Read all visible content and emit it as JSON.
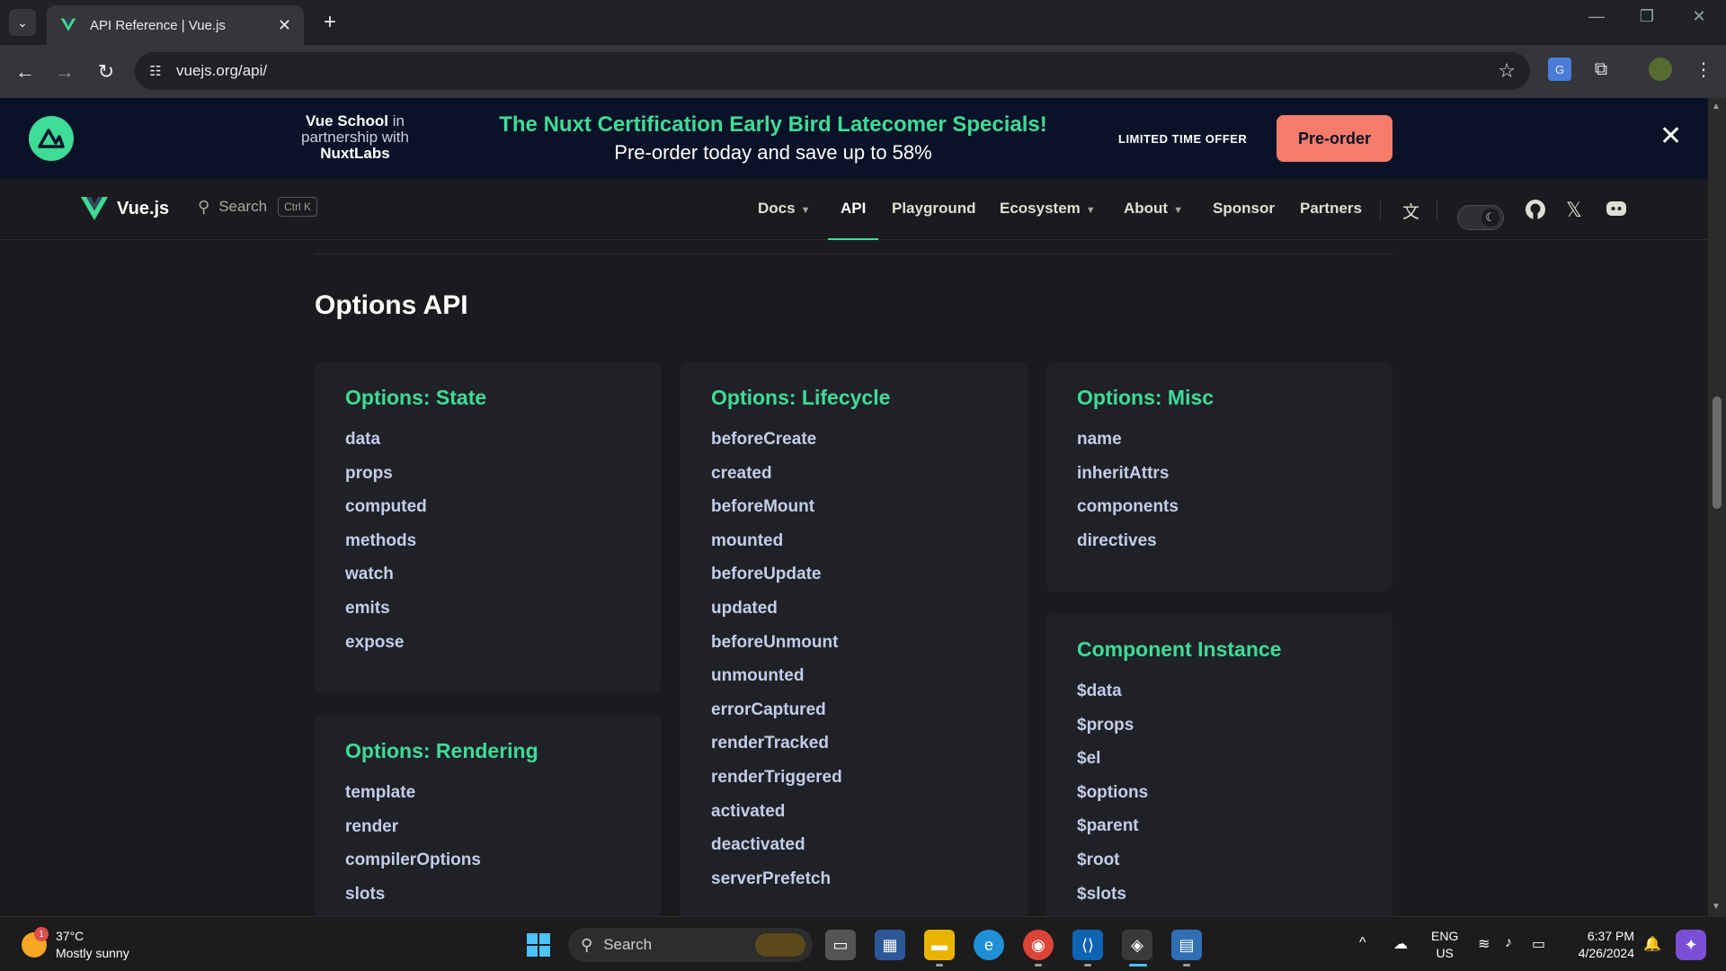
{
  "browser": {
    "tab_title": "API Reference | Vue.js",
    "url": "vuejs.org/api/"
  },
  "banner": {
    "brand_line1": "Vue School",
    "brand_line1_suffix": " in",
    "brand_line2": "partnership with",
    "brand_line3": "NuxtLabs",
    "headline": "The Nuxt Certification Early Bird Latecomer Specials!",
    "subline": "Pre-order today and save up to 58%",
    "limited": "LIMITED TIME OFFER",
    "cta": "Pre-order"
  },
  "nav": {
    "brand": "Vue.js",
    "search_label": "Search",
    "search_shortcut": "Ctrl K",
    "items": [
      {
        "label": "Docs"
      },
      {
        "label": "API"
      },
      {
        "label": "Playground"
      },
      {
        "label": "Ecosystem"
      },
      {
        "label": "About"
      },
      {
        "label": "Sponsor"
      },
      {
        "label": "Partners"
      }
    ]
  },
  "content": {
    "section_title": "Options API",
    "cards": {
      "state": {
        "title": "Options: State",
        "items": [
          "data",
          "props",
          "computed",
          "methods",
          "watch",
          "emits",
          "expose"
        ]
      },
      "rendering": {
        "title": "Options: Rendering",
        "items": [
          "template",
          "render",
          "compilerOptions",
          "slots"
        ]
      },
      "lifecycle": {
        "title": "Options: Lifecycle",
        "items": [
          "beforeCreate",
          "created",
          "beforeMount",
          "mounted",
          "beforeUpdate",
          "updated",
          "beforeUnmount",
          "unmounted",
          "errorCaptured",
          "renderTracked",
          "renderTriggered",
          "activated",
          "deactivated",
          "serverPrefetch"
        ]
      },
      "misc": {
        "title": "Options: Misc",
        "items": [
          "name",
          "inheritAttrs",
          "components",
          "directives"
        ]
      },
      "instance": {
        "title": "Component Instance",
        "items": [
          "$data",
          "$props",
          "$el",
          "$options",
          "$parent",
          "$root",
          "$slots"
        ]
      }
    }
  },
  "taskbar": {
    "temp": "37°C",
    "weather": "Mostly sunny",
    "weather_badge": "1",
    "search_label": "Search",
    "lang_line1": "ENG",
    "lang_line2": "US",
    "time": "6:37 PM",
    "date": "4/26/2024"
  },
  "colors": {
    "accent": "#3ddc97",
    "banner_bg": "#0a1227",
    "cta": "#f57c6b",
    "page_bg": "#1b1b1f",
    "card_bg": "#202127"
  }
}
